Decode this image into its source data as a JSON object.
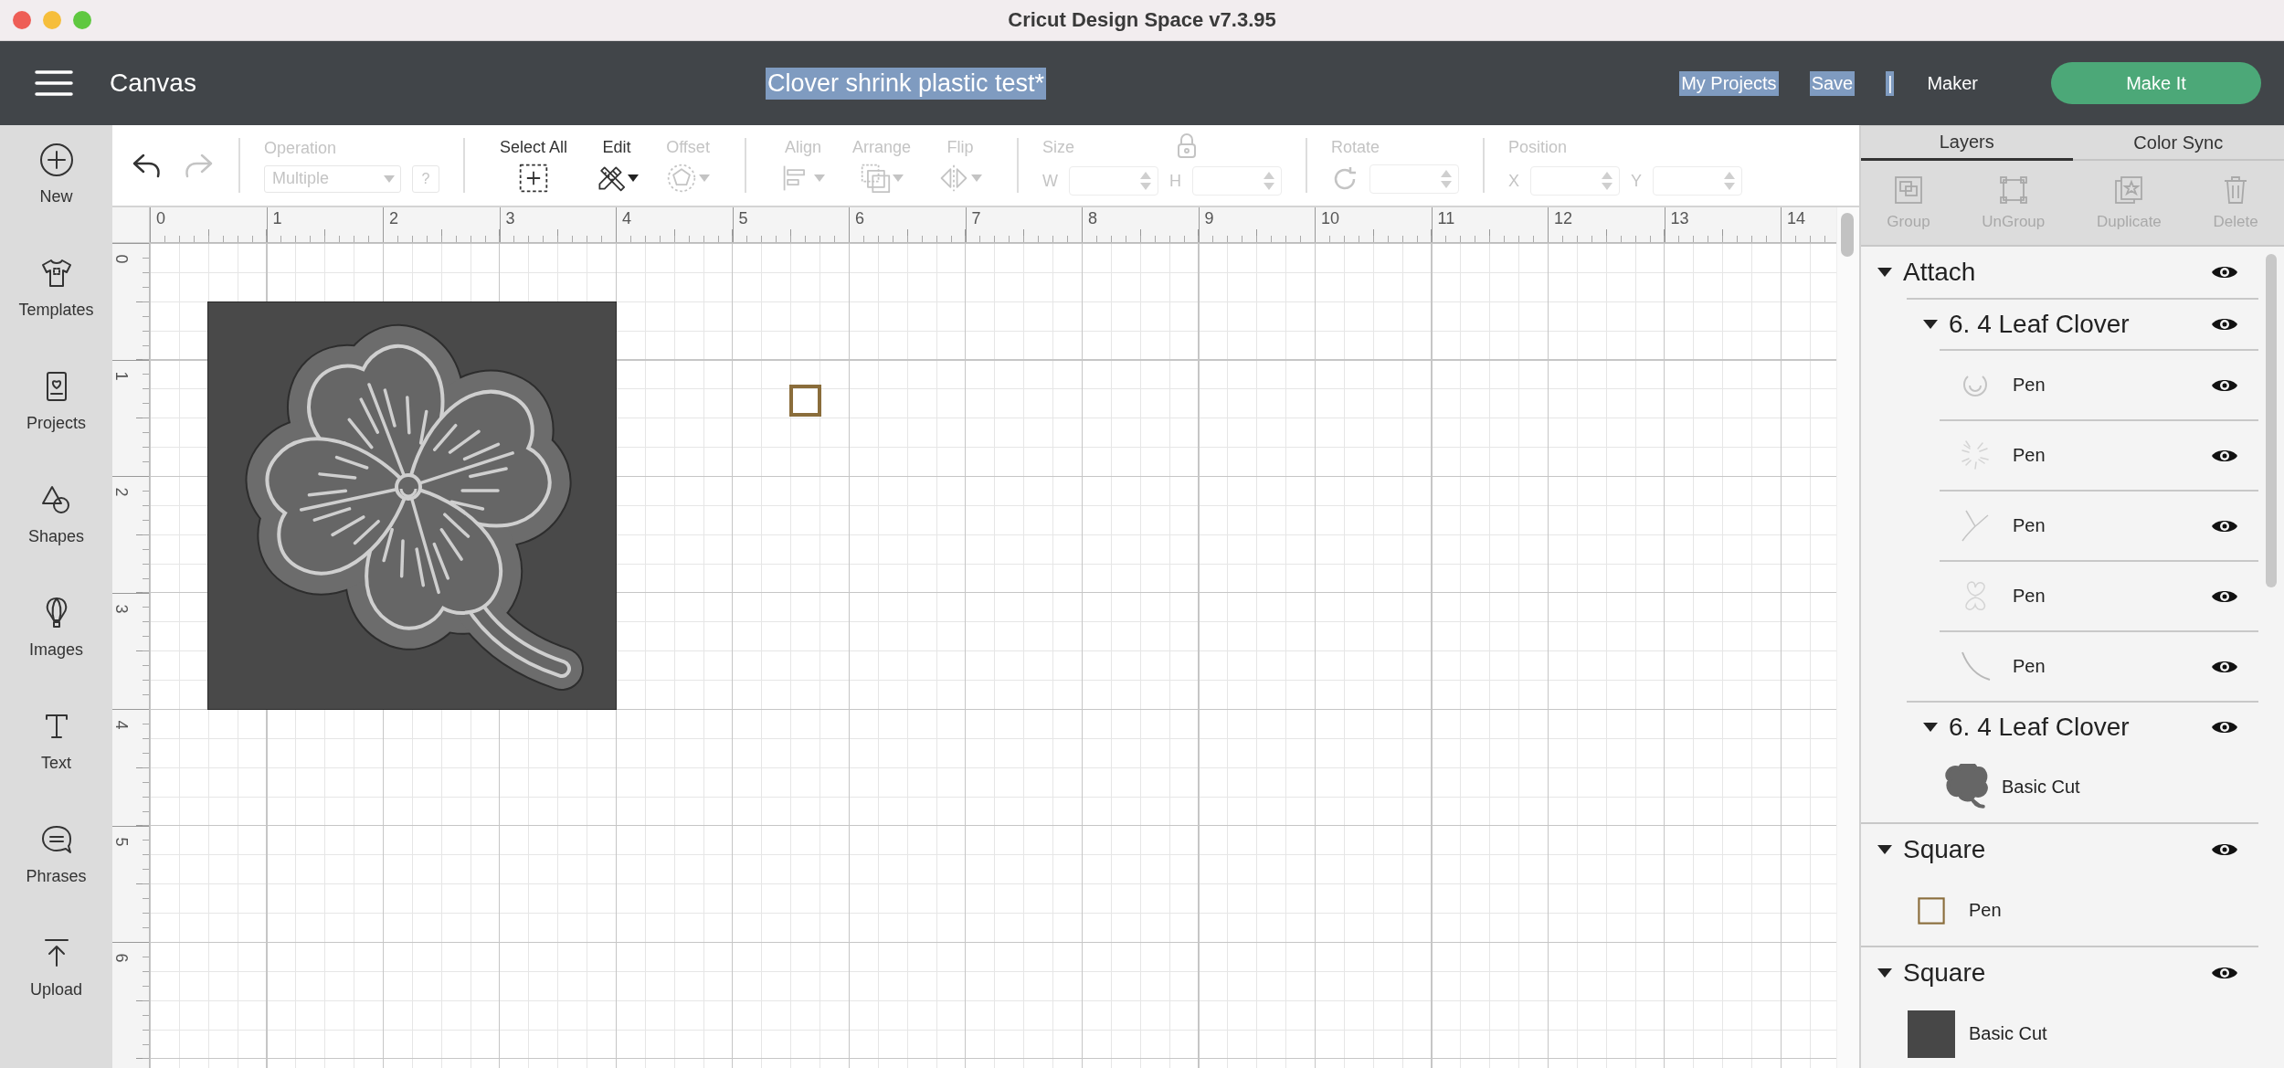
{
  "window": {
    "title": "Cricut Design Space  v7.3.95"
  },
  "header": {
    "section": "Canvas",
    "project_name": {
      "text": "Clover shrink plastic test*",
      "highlighted": true
    },
    "links": [
      {
        "label": "My Projects",
        "highlighted": true
      },
      {
        "label": "Save",
        "highlighted": true
      },
      {
        "label": "|",
        "highlighted": true
      },
      {
        "label": "Maker",
        "highlighted": false
      }
    ],
    "make_it_button": "Make It"
  },
  "sidebar": {
    "items": [
      {
        "label": "New"
      },
      {
        "label": "Templates"
      },
      {
        "label": "Projects"
      },
      {
        "label": "Shapes"
      },
      {
        "label": "Images"
      },
      {
        "label": "Text"
      },
      {
        "label": "Phrases"
      },
      {
        "label": "Upload"
      }
    ]
  },
  "toolbar": {
    "history": [
      {
        "kind": "undo",
        "disabled": false
      },
      {
        "kind": "redo",
        "disabled": true
      }
    ],
    "operation": {
      "label": "Operation",
      "value": "Multiple",
      "help": "?",
      "disabled": true
    },
    "tools": [
      {
        "label": "Select All",
        "disabled": false
      },
      {
        "label": "Edit",
        "disabled": false
      },
      {
        "label": "Offset",
        "disabled": true
      }
    ],
    "arrange_tools": [
      {
        "label": "Align",
        "disabled": true
      },
      {
        "label": "Arrange",
        "disabled": true
      },
      {
        "label": "Flip",
        "disabled": true
      }
    ],
    "size": {
      "label": "Size",
      "disabled": true,
      "fields": [
        {
          "label": "W"
        },
        {
          "label": "H"
        }
      ]
    },
    "rotate": {
      "label": "Rotate",
      "disabled": true
    },
    "position": {
      "label": "Position",
      "disabled": true,
      "fields": [
        {
          "label": "X"
        },
        {
          "label": "Y"
        }
      ]
    }
  },
  "canvas": {
    "x_ruler": [
      "0",
      "1",
      "2",
      "3",
      "4",
      "5",
      "6",
      "7",
      "8",
      "9",
      "10",
      "11",
      "12",
      "13",
      "14"
    ],
    "y_ruler": [
      "0",
      "1",
      "2",
      "3",
      "4",
      "5",
      "6"
    ]
  },
  "layers_panel": {
    "tabs": [
      {
        "label": "Layers",
        "selected": true
      },
      {
        "label": "Color Sync",
        "selected": false
      }
    ],
    "actions": [
      {
        "label": "Group",
        "disabled": true
      },
      {
        "label": "UnGroup",
        "disabled": true
      },
      {
        "label": "Duplicate",
        "disabled": true
      },
      {
        "label": "Delete",
        "disabled": true
      }
    ],
    "layers": [
      {
        "name": "Attach",
        "expanded": true,
        "visible": true,
        "children": [
          {
            "name": "6. 4 Leaf Clover",
            "expanded": true,
            "visible": true,
            "children": [
              {
                "name": "Pen",
                "kind": "smile",
                "color": "#c4c4c4",
                "visible": true
              },
              {
                "name": "Pen",
                "kind": "strokes",
                "color": "#d4d4d4",
                "visible": true
              },
              {
                "name": "Pen",
                "kind": "arcs",
                "color": "#c4c4c4",
                "visible": true
              },
              {
                "name": "Pen",
                "kind": "outline",
                "color": "#d4d4d4",
                "visible": true
              },
              {
                "name": "Pen",
                "kind": "stem",
                "color": "#b8b8b8",
                "visible": true
              }
            ]
          },
          {
            "name": "6. 4 Leaf Clover",
            "expanded": true,
            "visible": true,
            "children": [
              {
                "name": "Basic Cut",
                "kind": "clover",
                "color": "#666666"
              }
            ]
          }
        ]
      },
      {
        "name": "Square",
        "expanded": true,
        "visible": true,
        "children": [
          {
            "name": "Pen",
            "kind": "frame",
            "color": "#8a6d3b"
          }
        ]
      },
      {
        "name": "Square",
        "expanded": true,
        "visible": true,
        "children": [
          {
            "name": "Basic Cut",
            "kind": "block",
            "color": "#474747"
          }
        ]
      }
    ]
  }
}
